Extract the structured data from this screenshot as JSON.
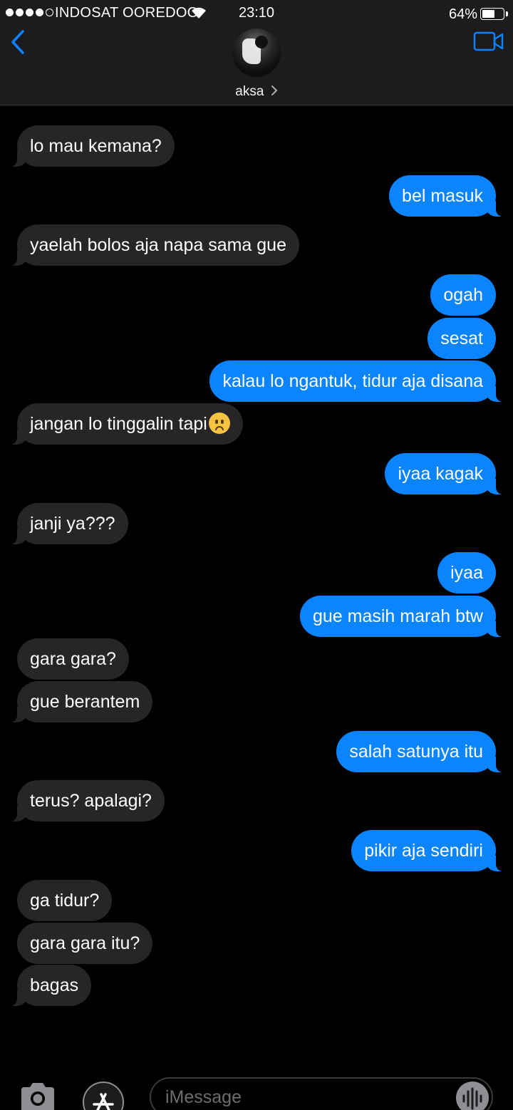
{
  "status_bar": {
    "carrier": "INDOSAT OOREDOO",
    "time": "23:10",
    "battery": "64%",
    "battery_level": 0.64
  },
  "header": {
    "contact_name": "aksa",
    "chevron": ">",
    "back_icon": "chevron-left-icon",
    "video_icon": "video-camera-icon"
  },
  "messages": [
    {
      "side": "in",
      "text": "lo mau kemana?"
    },
    {
      "side": "out",
      "text": "bel masuk"
    },
    {
      "side": "in",
      "text": "yaelah bolos aja napa sama gue"
    },
    {
      "side": "out",
      "text": "ogah"
    },
    {
      "side": "out",
      "text": "sesat"
    },
    {
      "side": "out",
      "text": "kalau lo ngantuk, tidur aja disana"
    },
    {
      "side": "in",
      "text": "jangan lo tinggalin tapi"
    },
    {
      "side": "out",
      "text": "iyaa kagak"
    },
    {
      "side": "in",
      "text": "janji ya???"
    },
    {
      "side": "out",
      "text": "iyaa"
    },
    {
      "side": "out",
      "text": "gue masih marah btw"
    },
    {
      "side": "in",
      "text": "gara gara?"
    },
    {
      "side": "in",
      "text": "gue berantem"
    },
    {
      "side": "out",
      "text": "salah satunya itu"
    },
    {
      "side": "in",
      "text": "terus? apalagi?"
    },
    {
      "side": "out",
      "text": "pikir aja sendiri"
    },
    {
      "side": "in",
      "text": "ga tidur?"
    },
    {
      "side": "in",
      "text": "gara gara itu?"
    },
    {
      "side": "in",
      "text": "bagas"
    }
  ],
  "colors": {
    "incoming_bubble": "#262628",
    "outgoing_bubble": "#0a84ff",
    "accent": "#0a84ff"
  },
  "input": {
    "placeholder": "iMessage"
  }
}
